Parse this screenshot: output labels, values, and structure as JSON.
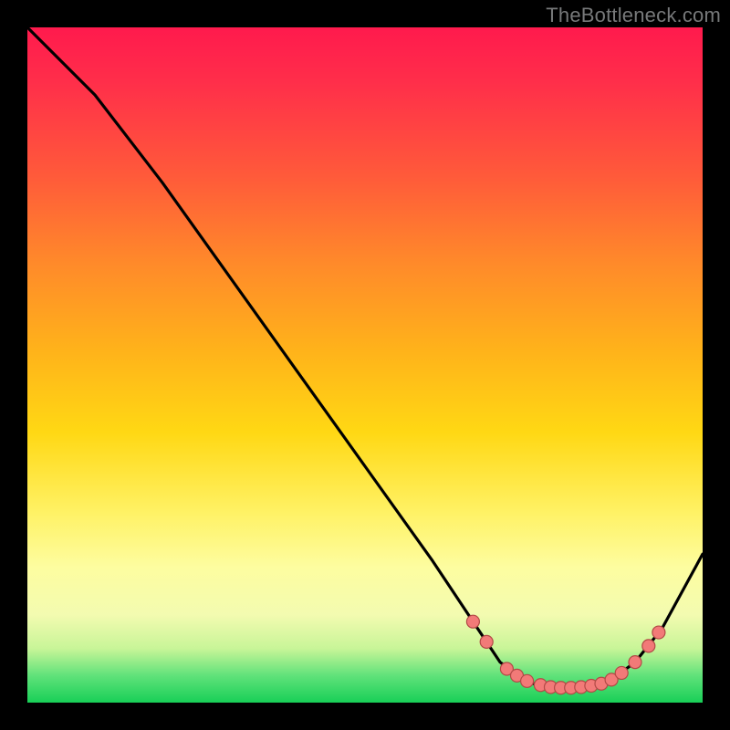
{
  "attribution": "TheBottleneck.com",
  "colors": {
    "curve": "#000000",
    "marker_fill": "#f27a78",
    "marker_stroke": "#b24a46"
  },
  "chart_data": {
    "type": "line",
    "title": "",
    "xlabel": "",
    "ylabel": "",
    "xlim": [
      0,
      100
    ],
    "ylim": [
      0,
      100
    ],
    "curve": [
      {
        "x": 0,
        "y": 100
      },
      {
        "x": 10,
        "y": 90
      },
      {
        "x": 20,
        "y": 77
      },
      {
        "x": 30,
        "y": 63
      },
      {
        "x": 40,
        "y": 49
      },
      {
        "x": 50,
        "y": 35
      },
      {
        "x": 60,
        "y": 21
      },
      {
        "x": 66,
        "y": 12
      },
      {
        "x": 70,
        "y": 6
      },
      {
        "x": 74,
        "y": 3
      },
      {
        "x": 78,
        "y": 2.2
      },
      {
        "x": 82,
        "y": 2.2
      },
      {
        "x": 86,
        "y": 3
      },
      {
        "x": 90,
        "y": 6
      },
      {
        "x": 94,
        "y": 11
      },
      {
        "x": 100,
        "y": 22
      }
    ],
    "markers": [
      {
        "x": 66,
        "y": 12
      },
      {
        "x": 68,
        "y": 9
      },
      {
        "x": 71,
        "y": 5
      },
      {
        "x": 72.5,
        "y": 4
      },
      {
        "x": 74,
        "y": 3.2
      },
      {
        "x": 76,
        "y": 2.6
      },
      {
        "x": 77.5,
        "y": 2.3
      },
      {
        "x": 79,
        "y": 2.2
      },
      {
        "x": 80.5,
        "y": 2.2
      },
      {
        "x": 82,
        "y": 2.3
      },
      {
        "x": 83.5,
        "y": 2.5
      },
      {
        "x": 85,
        "y": 2.8
      },
      {
        "x": 86.5,
        "y": 3.4
      },
      {
        "x": 88,
        "y": 4.4
      },
      {
        "x": 90,
        "y": 6
      },
      {
        "x": 92,
        "y": 8.4
      },
      {
        "x": 93.5,
        "y": 10.4
      }
    ]
  }
}
